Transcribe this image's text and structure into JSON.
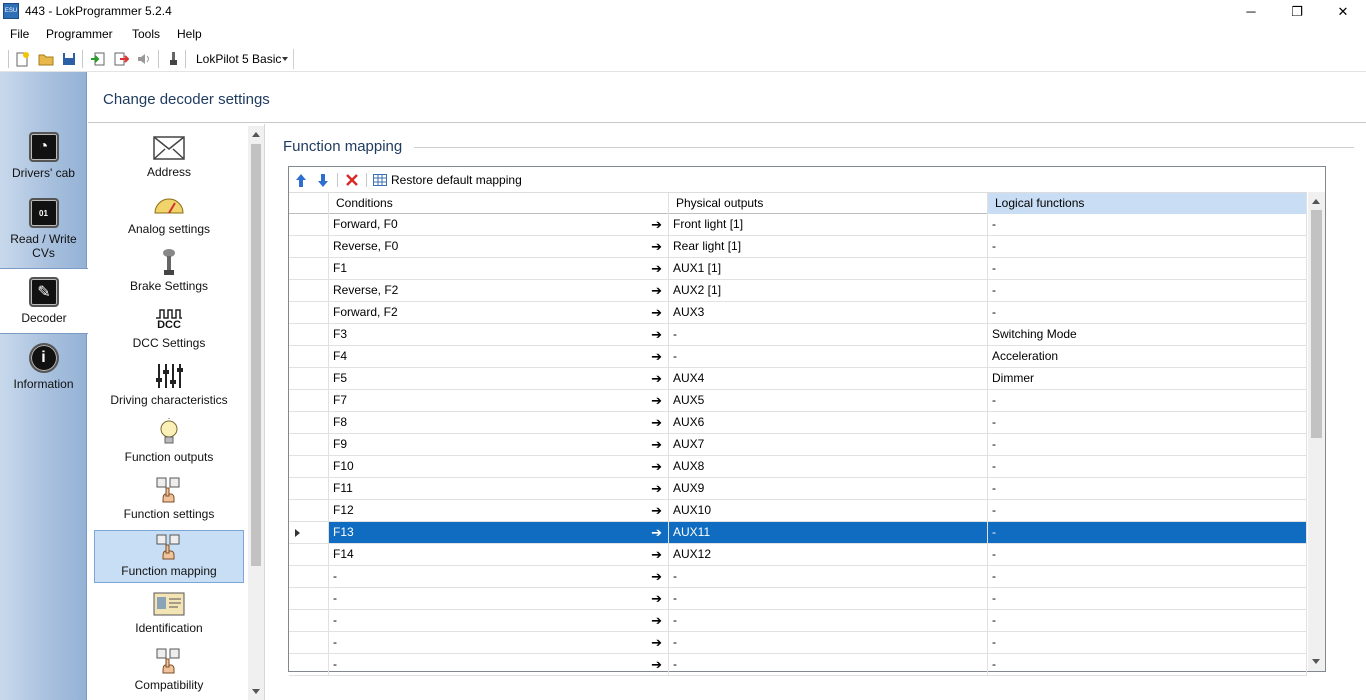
{
  "window": {
    "title": "443 - LokProgrammer 5.2.4",
    "app_icon_text": "ESU",
    "minimize": "─",
    "maximize": "❐",
    "close": "✕"
  },
  "menu": [
    "File",
    "Programmer",
    "Tools",
    "Help"
  ],
  "toolbar": {
    "decoder": "LokPilot 5 Basic"
  },
  "rail": [
    {
      "label": "Drivers' cab",
      "icon": "speedometer-icon"
    },
    {
      "label": "Read / Write CVs",
      "icon": "binary-icon"
    },
    {
      "label": "Decoder",
      "icon": "wrench-icon",
      "selected": true
    },
    {
      "label": "Information",
      "icon": "info-icon"
    }
  ],
  "header": {
    "title": "Change decoder settings"
  },
  "settings": [
    {
      "label": "Address",
      "icon": "envelope-icon"
    },
    {
      "label": "Analog settings",
      "icon": "gauge-icon"
    },
    {
      "label": "Brake Settings",
      "icon": "brake-lever-icon"
    },
    {
      "label": "DCC Settings",
      "icon": "dcc-icon",
      "icon_text": "DCC"
    },
    {
      "label": "Driving characteristics",
      "icon": "sliders-icon"
    },
    {
      "label": "Function outputs",
      "icon": "bulb-icon"
    },
    {
      "label": "Function settings",
      "icon": "function-keys-icon"
    },
    {
      "label": "Function mapping",
      "icon": "function-keys-icon",
      "selected": true
    },
    {
      "label": "Identification",
      "icon": "id-card-icon"
    },
    {
      "label": "Compatibility",
      "icon": "function-keys-icon"
    }
  ],
  "section_title": "Function mapping",
  "grid_toolbar": {
    "restore_label": "Restore default mapping"
  },
  "columns": {
    "conditions": "Conditions",
    "physical": "Physical outputs",
    "logical": "Logical functions"
  },
  "rows": [
    {
      "cond": "Forward, F0",
      "phys": "Front light [1]",
      "logic": "-"
    },
    {
      "cond": "Reverse, F0",
      "phys": "Rear light [1]",
      "logic": "-"
    },
    {
      "cond": "F1",
      "phys": "AUX1 [1]",
      "logic": "-"
    },
    {
      "cond": "Reverse, F2",
      "phys": "AUX2 [1]",
      "logic": "-"
    },
    {
      "cond": "Forward, F2",
      "phys": "AUX3",
      "logic": "-"
    },
    {
      "cond": "F3",
      "phys": "-",
      "logic": "Switching Mode"
    },
    {
      "cond": "F4",
      "phys": "-",
      "logic": "Acceleration"
    },
    {
      "cond": "F5",
      "phys": "AUX4",
      "logic": "Dimmer"
    },
    {
      "cond": "F7",
      "phys": "AUX5",
      "logic": "-"
    },
    {
      "cond": "F8",
      "phys": "AUX6",
      "logic": "-"
    },
    {
      "cond": "F9",
      "phys": "AUX7",
      "logic": "-"
    },
    {
      "cond": "F10",
      "phys": "AUX8",
      "logic": "-"
    },
    {
      "cond": "F11",
      "phys": "AUX9",
      "logic": "-"
    },
    {
      "cond": "F12",
      "phys": "AUX10",
      "logic": "-"
    },
    {
      "cond": "F13",
      "phys": "AUX11",
      "logic": "-",
      "selected": true
    },
    {
      "cond": "F14",
      "phys": "AUX12",
      "logic": "-"
    },
    {
      "cond": "-",
      "phys": "-",
      "logic": "-"
    },
    {
      "cond": "-",
      "phys": "-",
      "logic": "-"
    },
    {
      "cond": "-",
      "phys": "-",
      "logic": "-"
    },
    {
      "cond": "-",
      "phys": "-",
      "logic": "-"
    },
    {
      "cond": "-",
      "phys": "-",
      "logic": "-"
    }
  ],
  "arrow_glyph": "➔",
  "colors": {
    "selection": "#0f6cc0",
    "rail": "#a6bfdd",
    "header_text": "#1e3a5f"
  }
}
